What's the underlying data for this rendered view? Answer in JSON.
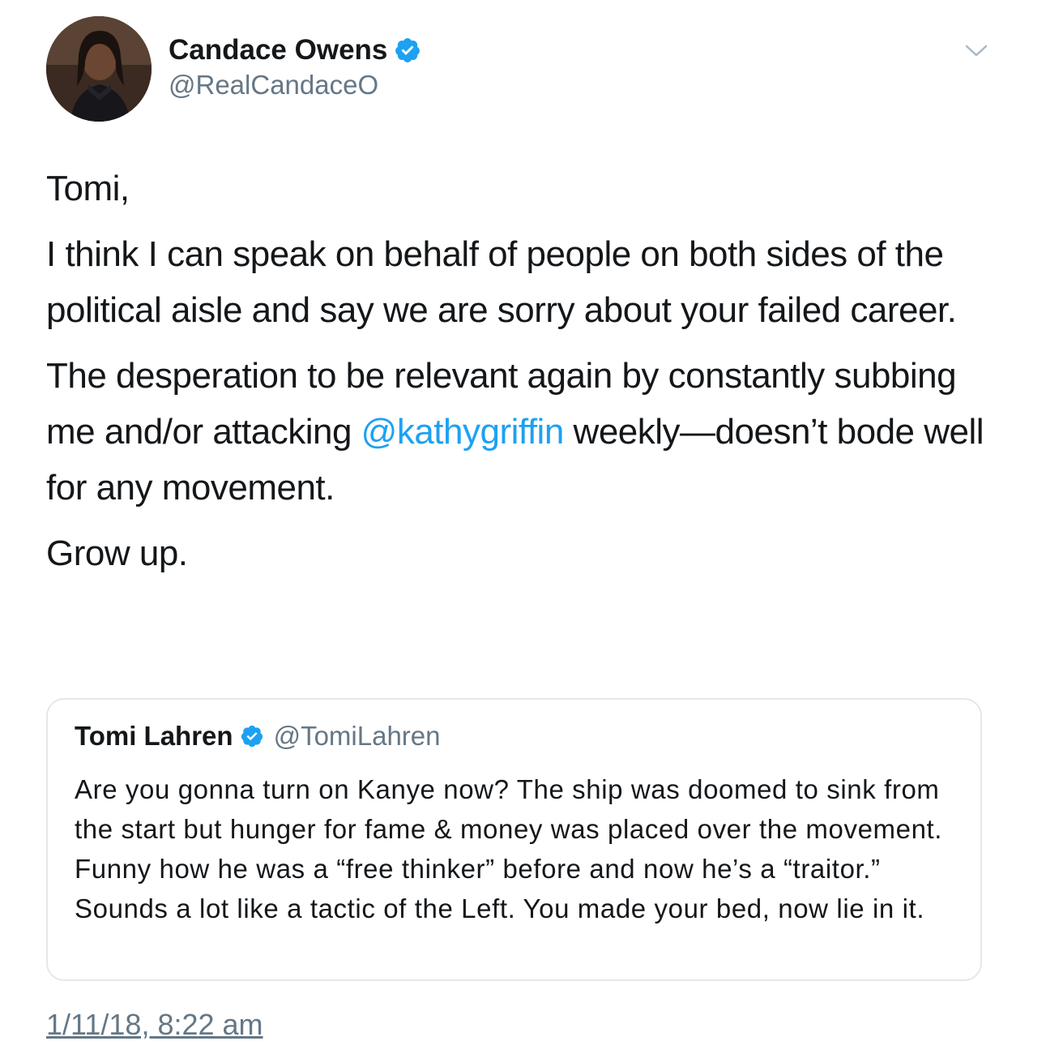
{
  "author": {
    "display_name": "Candace Owens",
    "handle": "@RealCandaceO",
    "verified_icon": "verified-badge-icon",
    "avatar": "avatar"
  },
  "menu": {
    "icon": "chevron-down-icon"
  },
  "tweet": {
    "greeting": "Tomi,",
    "paragraph_2": "I think I can speak on behalf of people on both sides of the political aisle and say we are sorry about your failed career.",
    "paragraph_3_before": "The desperation to be relevant again by constantly subbing me and/or attacking ",
    "paragraph_3_mention": "@kathygriffin",
    "paragraph_3_after": " weekly—doesn’t bode well for any movement.",
    "closing": "Grow up."
  },
  "quoted_tweet": {
    "display_name": "Tomi Lahren",
    "handle": "@TomiLahren",
    "text": "Are you gonna turn on Kanye now? The ship was doomed to sink from the start but hunger for fame & money was placed over the movement. Funny how he was a “free thinker” before and now he’s a “traitor.” Sounds a lot like a tactic of the Left. You made your bed, now lie in it."
  },
  "timestamp": "1/11/18, 8:22 am",
  "colors": {
    "text": "#14171a",
    "secondary": "#657786",
    "link": "#1da1f2",
    "border": "#e1e8ed"
  }
}
